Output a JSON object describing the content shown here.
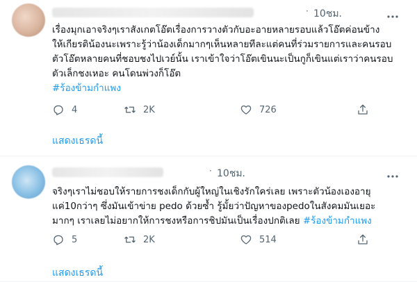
{
  "tweets": [
    {
      "time": "10ชม.",
      "dot": "·",
      "text": "เรื่องมุกเอาจริงๆเราสังเกตโอ๊ตเรื่องการวางตัวกับอะอายหลายรอบแล้วโอ๊ตค่อนข้าง\nให้เกียรติน้องนะเพราะรู้ว่าน้องเด็กมากๆเห็นหลายทีละแต่คนที่ร่วมรายการและคนรอบ\nตัวโอ๊ตหลายคนที่ชอบชงไปเวย์นั้น เราเข้าใจว่าโอ๊ตเขินนะเป็นกูก็เขินแต่เราว่าคนรอบ\nตัวเล็กชงเหอะ คนโดนพ่วงก็โอ๊ต",
      "hashtag": "#ร้องข้ามกำแพง",
      "replies": "4",
      "retweets": "2K",
      "likes": "726",
      "show_thread": "แสดงเธรดนี้"
    },
    {
      "time": "10ชม.",
      "dot": "·",
      "text": "จริงๆเราไม่ชอบให้รายการชงเด็กกับผู้ใหญ่ในเชิงรักใคร่เลย เพราะตัวน้องเองอายุ\nแค่10กว่าๆ ซึ่งมันเข้าข่าย pedo ด้วยซ้ำ รู้มั้ยว่าปัญหาของpedoในสังคมมันเยอะ\nมากๆ เราเลยไม่อยากให้การชงหรือการชิปมันเป็นเรื่องปกติเลย ",
      "hashtag": "#ร้องข้ามกำแพง",
      "replies": "5",
      "retweets": "2K",
      "likes": "514",
      "show_thread": "แสดงเธรดนี้"
    }
  ],
  "icons": {
    "reply": "reply-icon",
    "retweet": "retweet-icon",
    "like": "heart-icon",
    "share": "share-icon",
    "more": "more-icon"
  },
  "colors": {
    "link": "#1d9bf0",
    "muted": "#536471",
    "text": "#0f1419"
  }
}
